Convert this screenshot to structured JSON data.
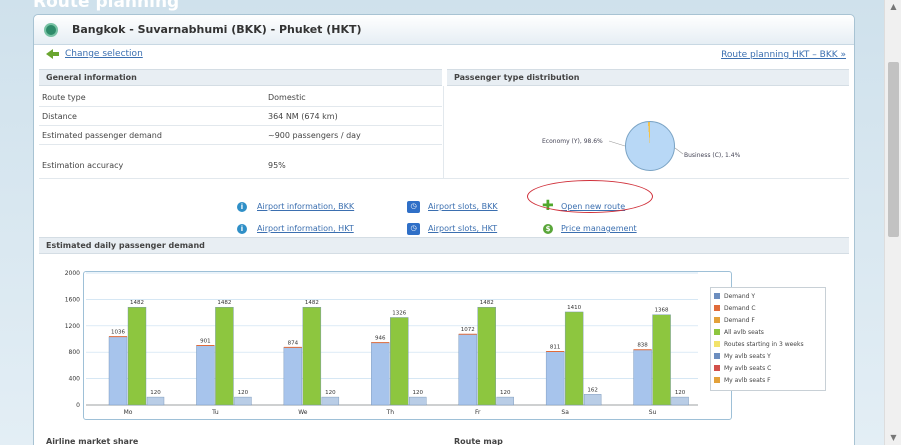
{
  "page": {
    "title": "Route planning"
  },
  "header": {
    "route_title": "Bangkok - Suvarnabhumi (BKK) - Phuket (HKT)"
  },
  "nav": {
    "change_selection": "Change selection",
    "route_planning_link": "Route planning HKT – BKK »"
  },
  "general": {
    "heading": "General information",
    "rows": [
      {
        "label": "Route type",
        "value": "Domestic"
      },
      {
        "label": "Distance",
        "value": "364 NM (674 km)"
      },
      {
        "label": "Estimated passenger demand",
        "value": "~900 passengers / day"
      },
      {
        "label": "Estimation accuracy",
        "value": "95%"
      }
    ]
  },
  "passenger": {
    "heading": "Passenger type distribution",
    "economy_label": "Economy (Y), 98.6%",
    "business_label": "Business (C), 1.4%",
    "economy_pct": 98.6,
    "business_pct": 1.4,
    "economy_color": "#b8d8f6",
    "business_color": "#f3c24a"
  },
  "actions": {
    "airport_info_bkk": "Airport information, BKK",
    "airport_info_hkt": "Airport information, HKT",
    "airport_slots_bkk": "Airport slots, BKK",
    "airport_slots_hkt": "Airport slots, HKT",
    "open_new_route": "Open new route",
    "price_management": "Price management",
    "highlight_color": "#d0303a"
  },
  "daily": {
    "heading": "Estimated daily passenger demand"
  },
  "bottom": {
    "market_share": "Airline market share",
    "route_map": "Route map"
  },
  "chart_data": {
    "type": "bar",
    "categories": [
      "Mo",
      "Tu",
      "We",
      "Th",
      "Fr",
      "Sa",
      "Su"
    ],
    "ylim": [
      0,
      2000
    ],
    "yticks": [
      0,
      400,
      800,
      1200,
      1600,
      2000
    ],
    "grid": true,
    "legend_position": "right",
    "series": [
      {
        "name": "Demand Y",
        "values": [
          1036,
          901,
          874,
          946,
          1072,
          811,
          838
        ],
        "color": "#a7c4ec"
      },
      {
        "name": "All avlb seats",
        "values": [
          1482,
          1482,
          1482,
          1326,
          1482,
          1410,
          1368
        ],
        "color": "#8dc63f"
      },
      {
        "name": "My avlb seats C",
        "values": [
          120,
          120,
          120,
          120,
          120,
          162,
          120
        ],
        "color": "#b9cde6"
      }
    ],
    "legend": [
      {
        "name": "Demand Y",
        "color": "#6c8ebf"
      },
      {
        "name": "Demand C",
        "color": "#e06b3a"
      },
      {
        "name": "Demand F",
        "color": "#e3a13a"
      },
      {
        "name": "All avlb seats",
        "color": "#8dc63f"
      },
      {
        "name": "Routes starting in 3 weeks",
        "color": "#f2e36a"
      },
      {
        "name": "My avlb seats Y",
        "color": "#6c8ebf"
      },
      {
        "name": "My avlb seats C",
        "color": "#d2504a"
      },
      {
        "name": "My avlb seats F",
        "color": "#e3a13a"
      }
    ]
  }
}
